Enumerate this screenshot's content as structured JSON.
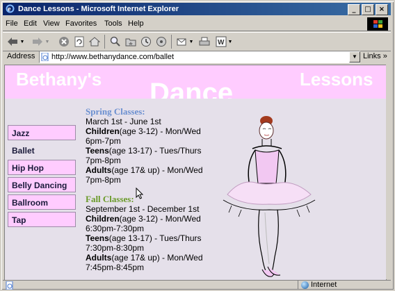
{
  "window": {
    "title": "Dance Lessons - Microsoft Internet Explorer",
    "minimize": "_",
    "maximize": "□",
    "close": "×"
  },
  "menu": {
    "items": [
      "File",
      "Edit",
      "View",
      "Favorites",
      "Tools",
      "Help"
    ]
  },
  "toolbar": {
    "buttons": [
      "back",
      "forward",
      "stop",
      "refresh",
      "home",
      "search",
      "favorites",
      "history",
      "mail",
      "print",
      "edit",
      "discuss"
    ]
  },
  "address": {
    "label": "Address",
    "url": "http://www.bethanydance.com/ballet",
    "links_label": "Links",
    "links_arrow": "»"
  },
  "page": {
    "header": {
      "left": "Bethany's",
      "middle": "Dance",
      "right": "Lessons"
    },
    "nav": [
      {
        "label": "Jazz",
        "active": false
      },
      {
        "label": "Ballet",
        "active": true
      },
      {
        "label": "Hip Hop",
        "active": false
      },
      {
        "label": "Belly Dancing",
        "active": false
      },
      {
        "label": "Ballroom",
        "active": false
      },
      {
        "label": "Tap",
        "active": false
      }
    ],
    "spring": {
      "heading": "Spring Classes:",
      "dates": "March 1st - June 1st",
      "children_label": "Children",
      "children_age": "(age 3-12) - Mon/Wed",
      "children_time": "6pm-7pm",
      "teens_label": "Teens",
      "teens_age": "(age 13-17) - Tues/Thurs",
      "teens_time": "7pm-8pm",
      "adults_label": "Adults",
      "adults_age": "(age 17& up) - Mon/Wed",
      "adults_time": "7pm-8pm"
    },
    "fall": {
      "heading": "Fall Classes:",
      "dates": "September 1st - December 1st",
      "children_label": "Children",
      "children_age": "(age 3-12) - Mon/Wed",
      "children_time": "6:30pm-7:30pm",
      "teens_label": "Teens",
      "teens_age": "(age 13-17) - Tues/Thurs",
      "teens_time": "7:30pm-8:30pm",
      "adults_label": "Adults",
      "adults_age": "(age 17& up) - Mon/Wed",
      "adults_time": "7:45pm-8:45pm"
    },
    "colors": {
      "header_bg": "#ffccff",
      "content_bg": "#e5e0ea",
      "spring_heading": "#6a8fd0",
      "fall_heading": "#6a9a2a"
    }
  },
  "status": {
    "zone": "Internet"
  }
}
